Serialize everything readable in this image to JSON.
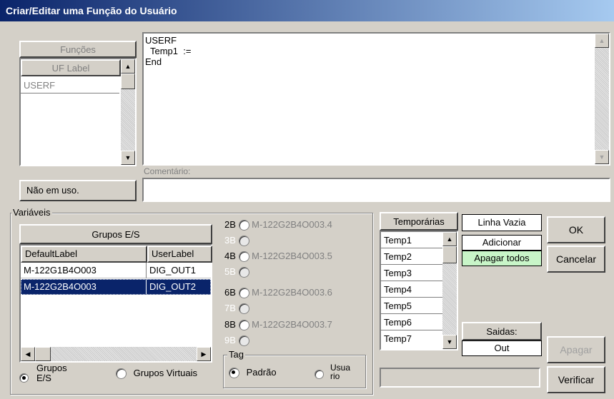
{
  "window": {
    "title": "Criar/Editar uma Função do Usuário"
  },
  "functions_panel": {
    "header": "Funções",
    "column": "UF Label",
    "items": [
      "USERF"
    ]
  },
  "editor": {
    "lines": [
      "USERF",
      "  Temp1  :=",
      "End"
    ]
  },
  "comment": {
    "label": "Comentário:",
    "value": ""
  },
  "usage_status": "Não em uso.",
  "variables": {
    "legend": "Variáveis",
    "groups_header": "Grupos E/S",
    "columns": [
      "DefaultLabel",
      "UserLabel"
    ],
    "rows": [
      {
        "default": "M-122G1B4O003",
        "user": "DIG_OUT1",
        "selected": false
      },
      {
        "default": "M-122G2B4O003",
        "user": "DIG_OUT2",
        "selected": true
      }
    ],
    "radio_groups_es": "Grupos E/S",
    "radio_groups_virtual": "Grupos Virtuais"
  },
  "bits": [
    {
      "label": "2B",
      "value": "M-122G2B4O003.4",
      "enabled": true
    },
    {
      "label": "3B",
      "value": "",
      "enabled": false
    },
    {
      "label": "4B",
      "value": "M-122G2B4O003.5",
      "enabled": true
    },
    {
      "label": "5B",
      "value": "",
      "enabled": false
    },
    {
      "label": "6B",
      "value": "M-122G2B4O003.6",
      "enabled": true
    },
    {
      "label": "7B",
      "value": "",
      "enabled": false
    },
    {
      "label": "8B",
      "value": "M-122G2B4O003.7",
      "enabled": true
    },
    {
      "label": "9B",
      "value": "",
      "enabled": false
    }
  ],
  "tag": {
    "legend": "Tag",
    "option_default": "Padrão",
    "option_user": "Usua\nrio"
  },
  "temporaries": {
    "header": "Temporárias",
    "items": [
      "Temp1",
      "Temp2",
      "Temp3",
      "Temp4",
      "Temp5",
      "Temp6",
      "Temp7"
    ]
  },
  "empty_line": {
    "header": "Linha Vazia",
    "add": "Adicionar",
    "clear_all": "Apagar todos"
  },
  "outputs": {
    "header": "Saidas:",
    "value": "Out"
  },
  "buttons": {
    "ok": "OK",
    "cancel": "Cancelar",
    "delete": "Apagar",
    "verify": "Verificar"
  },
  "colors": {
    "title_start": "#0a246a",
    "title_end": "#a6caf0",
    "selection": "#0a246a",
    "clear_all_bg": "#c8f5c8"
  }
}
